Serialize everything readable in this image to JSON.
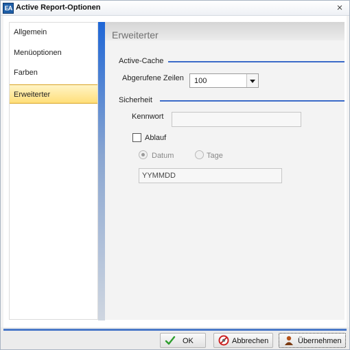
{
  "window": {
    "title": "Active Report-Optionen",
    "app_icon": "EA",
    "close_glyph": "×"
  },
  "sidebar": {
    "items": [
      {
        "label": "Allgemein",
        "selected": false
      },
      {
        "label": "Menüoptionen",
        "selected": false
      },
      {
        "label": "Farben",
        "selected": false
      },
      {
        "label": "Erweiterter",
        "selected": true
      }
    ]
  },
  "panel": {
    "title": "Erweiterter",
    "cache_section": "Active-Cache",
    "rows_label": "Abgerufene Zeilen",
    "rows_value": "100",
    "security_section": "Sicherheit",
    "password_label": "Kennwort",
    "password_value": "",
    "expiry_label": "Ablauf",
    "expiry_checked": false,
    "radio_date_label": "Datum",
    "radio_days_label": "Tage",
    "radio_selected": "Datum",
    "date_value": "YYMMDD"
  },
  "footer": {
    "ok_label": "OK",
    "cancel_label": "Abbrechen",
    "apply_label": "Übernehmen"
  },
  "colors": {
    "accent_blue": "#3a6ac8",
    "selected_item": "#ffdf7a",
    "ok_icon": "#2e9e2e",
    "cancel_icon": "#cc2222",
    "apply_icon": "#b5521a"
  },
  "icons": {
    "ok": "checkmark-icon",
    "cancel": "no-entry-icon",
    "apply": "person-icon",
    "close": "close-icon",
    "dropdown": "chevron-down-icon"
  }
}
